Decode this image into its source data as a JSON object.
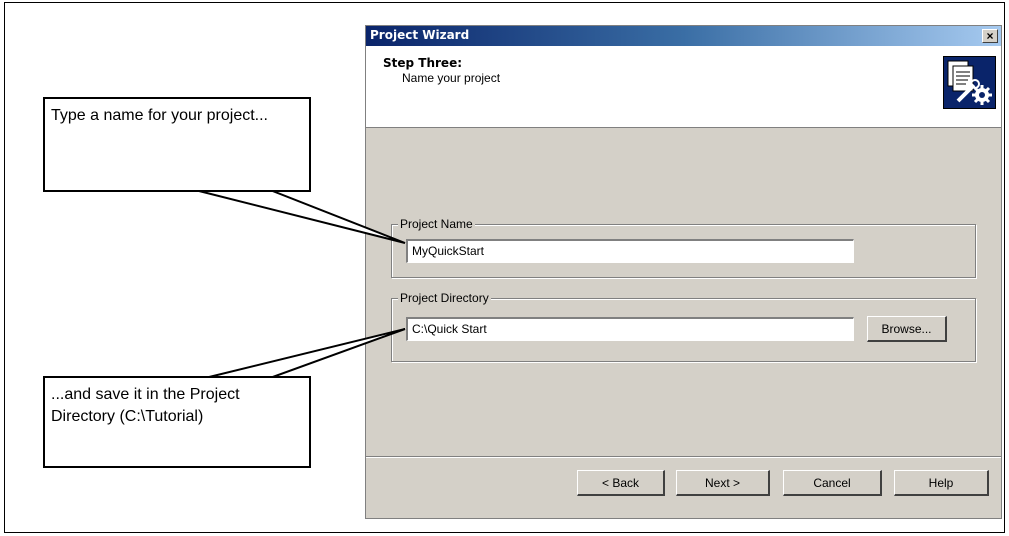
{
  "dialog": {
    "title": "Project Wizard",
    "close_glyph": "×",
    "step_title": "Step Three:",
    "step_subtitle": "Name your project",
    "icon": "wizard-tools-icon"
  },
  "project_name": {
    "legend": "Project Name",
    "value": "MyQuickStart"
  },
  "project_directory": {
    "legend": "Project Directory",
    "value": "C:\\Quick Start",
    "browse_label": "Browse..."
  },
  "buttons": {
    "back": "< Back",
    "next": "Next >",
    "cancel": "Cancel",
    "help": "Help"
  },
  "callouts": {
    "top": "Type a name for your project...",
    "bottom": "...and save it in the Project Directory (C:\\Tutorial)"
  },
  "colors": {
    "titlebar_start": "#0a246a",
    "dialog_face": "#d4d0c8"
  }
}
